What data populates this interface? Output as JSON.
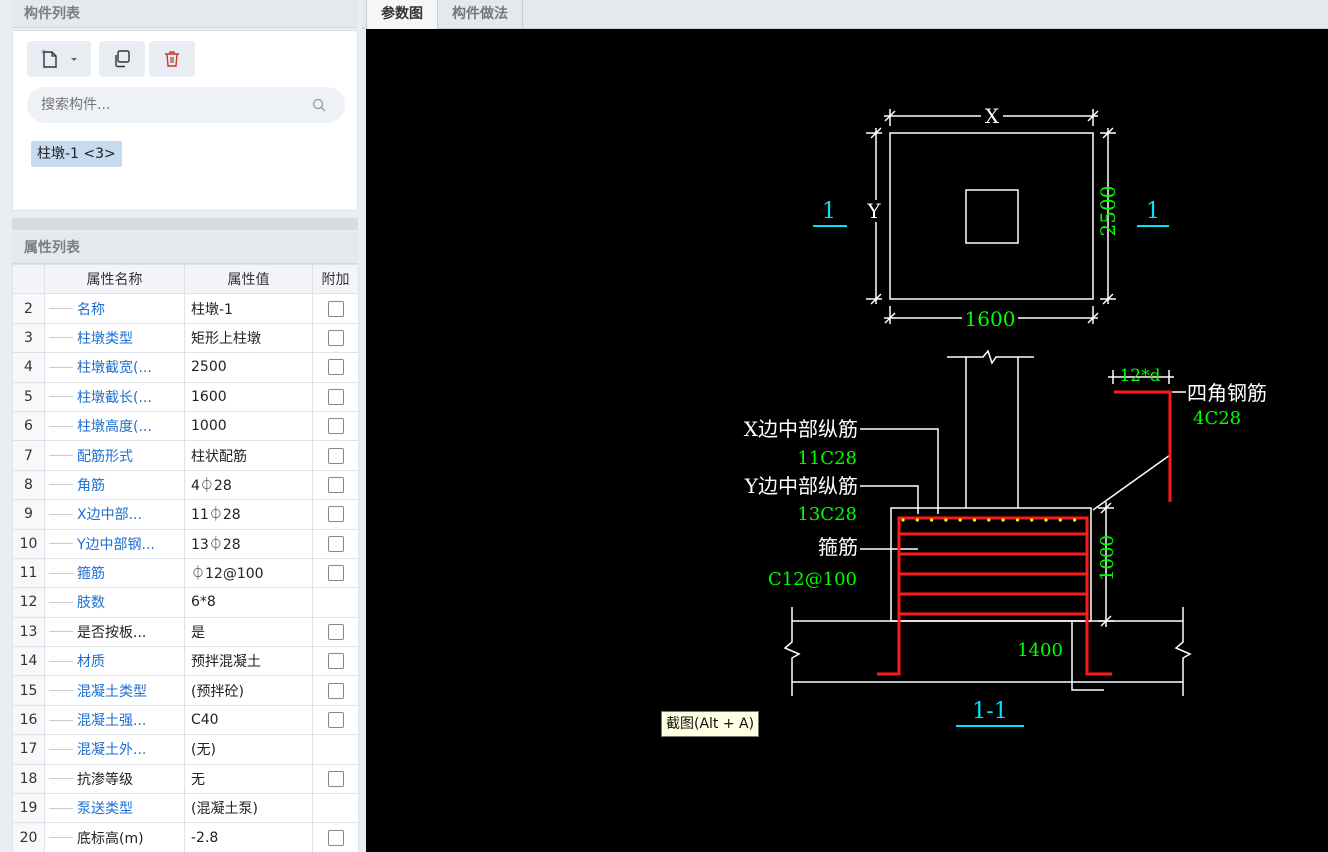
{
  "component_list": {
    "title": "构件列表",
    "search_placeholder": "搜索构件...",
    "items": [
      {
        "label": "柱墩-1 <3>"
      }
    ]
  },
  "property_list": {
    "title": "属性列表",
    "headers": [
      "属性名称",
      "属性值",
      "附加"
    ],
    "rows": [
      {
        "num": "2",
        "name": "名称",
        "value": "柱墩-1",
        "color": "blue",
        "check": true
      },
      {
        "num": "3",
        "name": "柱墩类型",
        "value": "矩形上柱墩",
        "color": "blue",
        "check": true
      },
      {
        "num": "4",
        "name": "柱墩截宽(...",
        "value": "2500",
        "color": "blue",
        "check": true
      },
      {
        "num": "5",
        "name": "柱墩截长(...",
        "value": "1600",
        "color": "blue",
        "check": true
      },
      {
        "num": "6",
        "name": "柱墩高度(...",
        "value": "1000",
        "color": "blue",
        "check": true
      },
      {
        "num": "7",
        "name": "配筋形式",
        "value": "柱状配筋",
        "color": "blue",
        "check": true
      },
      {
        "num": "8",
        "name": "角筋",
        "value": "4⏀28",
        "color": "blue",
        "check": true
      },
      {
        "num": "9",
        "name": "X边中部...",
        "value": "11⏀28",
        "color": "blue",
        "check": true
      },
      {
        "num": "10",
        "name": "Y边中部钢...",
        "value": "13⏀28",
        "color": "blue",
        "check": true
      },
      {
        "num": "11",
        "name": "箍筋",
        "value": "⏀12@100",
        "color": "blue",
        "check": true
      },
      {
        "num": "12",
        "name": "肢数",
        "value": "6*8",
        "color": "blue",
        "check": false
      },
      {
        "num": "13",
        "name": "是否按板...",
        "value": "是",
        "color": "dark",
        "check": true
      },
      {
        "num": "14",
        "name": "材质",
        "value": "预拌混凝土",
        "color": "blue",
        "check": true
      },
      {
        "num": "15",
        "name": "混凝土类型",
        "value": "(预拌砼)",
        "color": "blue",
        "check": true
      },
      {
        "num": "16",
        "name": "混凝土强...",
        "value": "C40",
        "color": "blue",
        "check": true
      },
      {
        "num": "17",
        "name": "混凝土外...",
        "value": "(无)",
        "color": "blue",
        "check": false
      },
      {
        "num": "18",
        "name": "抗渗等级",
        "value": "无",
        "color": "dark",
        "check": true
      },
      {
        "num": "19",
        "name": "泵送类型",
        "value": "(混凝土泵)",
        "color": "blue",
        "check": false
      },
      {
        "num": "20",
        "name": "底标高(m)",
        "value": "-2.8",
        "color": "dark",
        "check": true
      }
    ]
  },
  "tabs": [
    "参数图",
    "构件做法"
  ],
  "drawing": {
    "plan": {
      "x_label": "X",
      "y_label": "Y",
      "width_dim": "2500",
      "length_dim": "1600",
      "section_mark": "1"
    },
    "section": {
      "title": "1-1",
      "corner_len": "12*d",
      "corner_label": "四角钢筋",
      "corner_value": "4C28",
      "x_mid_label": "X边中部纵筋",
      "x_mid_value": "11C28",
      "y_mid_label": "Y边中部纵筋",
      "y_mid_value": "13C28",
      "stirrup_label": "箍筋",
      "stirrup_value": "C12@100",
      "height_dim": "1000",
      "base_dim": "1400"
    },
    "colors": {
      "line": "#ffffff",
      "dim_text": "#00ff00",
      "section_mark": "#00e5ff",
      "rebar": "#ff1a1a",
      "dots": "#ffff00"
    }
  },
  "tooltip": "截图(Alt + A)"
}
